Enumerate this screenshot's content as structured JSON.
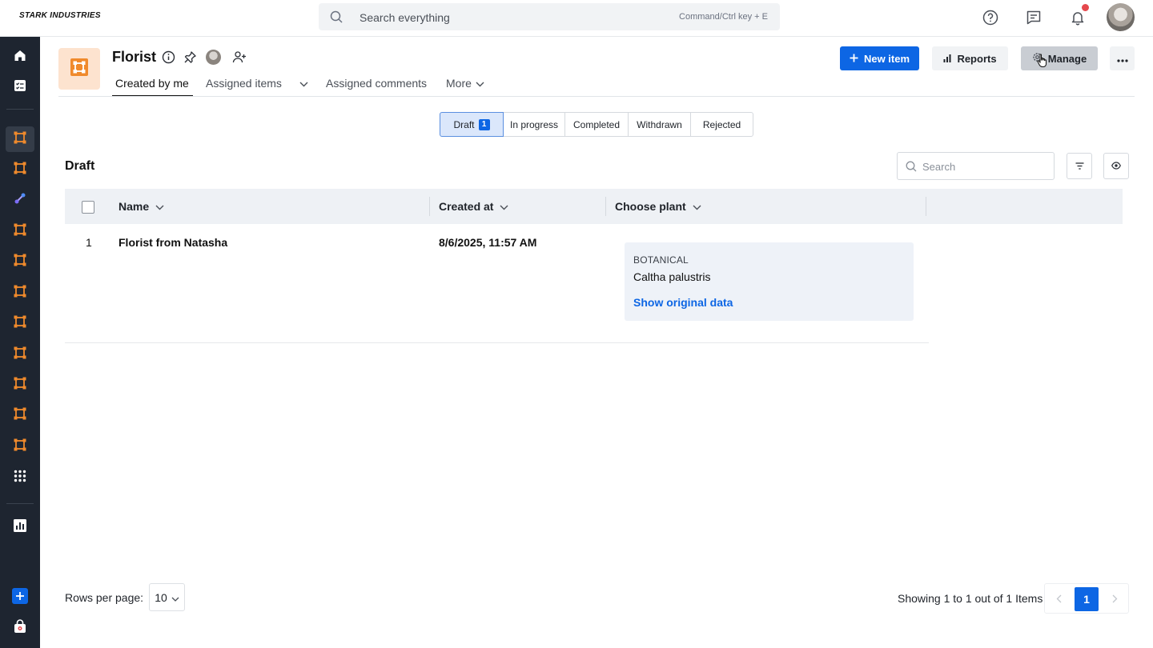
{
  "brand": {
    "logo_text": "STARK INDUSTRIES"
  },
  "topbar": {
    "search_placeholder": "Search everything",
    "search_hint": "Command/Ctrl key + E",
    "help_icon": "help-circle-icon",
    "chat_icon": "message-icon",
    "bell_icon": "bell-icon",
    "has_notification": true
  },
  "sidebar": {
    "items": [
      {
        "icon": "home-icon"
      },
      {
        "icon": "tasks-icon"
      },
      {
        "icon": "workflow-icon",
        "active": true
      },
      {
        "icon": "workflow-icon"
      },
      {
        "icon": "integration-icon"
      },
      {
        "icon": "workflow-icon"
      },
      {
        "icon": "workflow-icon"
      },
      {
        "icon": "workflow-icon"
      },
      {
        "icon": "workflow-icon"
      },
      {
        "icon": "workflow-icon"
      },
      {
        "icon": "workflow-icon"
      },
      {
        "icon": "workflow-icon"
      },
      {
        "icon": "workflow-icon"
      },
      {
        "icon": "apps-grid-icon"
      },
      {
        "icon": "reports-icon"
      },
      {
        "icon": "add-icon"
      },
      {
        "icon": "marketplace-icon"
      }
    ]
  },
  "header": {
    "title": "Florist",
    "tabs": [
      {
        "label": "Created by me",
        "active": true
      },
      {
        "label": "Assigned items"
      },
      {
        "label": "Assigned comments"
      },
      {
        "label": "More"
      }
    ],
    "buttons": {
      "new_item": "New item",
      "reports": "Reports",
      "manage": "Manage"
    }
  },
  "status_filter": {
    "options": [
      {
        "label": "Draft",
        "count": "1",
        "active": true
      },
      {
        "label": "In progress"
      },
      {
        "label": "Completed"
      },
      {
        "label": "Withdrawn"
      },
      {
        "label": "Rejected"
      }
    ]
  },
  "section": {
    "title": "Draft",
    "search_placeholder": "Search"
  },
  "table": {
    "columns": [
      "Name",
      "Created at",
      "Choose plant"
    ],
    "rows": [
      {
        "index": "1",
        "name": "Florist from Natasha",
        "created_at": "8/6/2025, 11:57 AM",
        "plant": {
          "category": "BOTANICAL",
          "name": "Caltha palustris",
          "link": "Show original data"
        }
      }
    ]
  },
  "footer": {
    "rows_per_page_label": "Rows per page:",
    "rows_per_page_value": "10",
    "showing_text": "Showing 1 to 1 out of 1 Items",
    "current_page": "1"
  },
  "colors": {
    "primary": "#0d66e4",
    "sidebar_bg": "#1e2530",
    "workflow_orange": "#f08a2c",
    "notification": "#e5484d"
  }
}
